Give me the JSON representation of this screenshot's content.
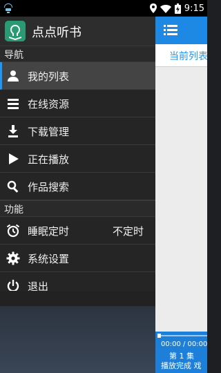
{
  "status_bar": {
    "time": "9:15",
    "icons": [
      "notification-icon",
      "location-icon",
      "wifi-icon",
      "battery-icon"
    ]
  },
  "drawer": {
    "app_title": "点点听书",
    "sections": [
      {
        "title": "导航",
        "items": [
          {
            "label": "我的列表",
            "icon": "person-icon",
            "active": true
          },
          {
            "label": "在线资源",
            "icon": "list-icon"
          },
          {
            "label": "下载管理",
            "icon": "download-icon"
          },
          {
            "label": "正在播放",
            "icon": "play-icon"
          },
          {
            "label": "作品搜索",
            "icon": "search-icon"
          }
        ]
      },
      {
        "title": "功能",
        "items": [
          {
            "label": "睡眠定时",
            "icon": "timer-icon",
            "value": "不定时"
          },
          {
            "label": "系统设置",
            "icon": "gear-icon"
          },
          {
            "label": "退出",
            "icon": "power-icon"
          }
        ]
      }
    ]
  },
  "background_app": {
    "tab_label": "当前列表",
    "player": {
      "time": "00:00 / 00:00",
      "episode": "第 1 集",
      "controls_text": "播放完成   戏"
    }
  },
  "colors": {
    "accent": "#2196f3",
    "drawer_bg": "#262626",
    "player_bg": "#1e7fd8",
    "logo": "#2a9a74"
  }
}
